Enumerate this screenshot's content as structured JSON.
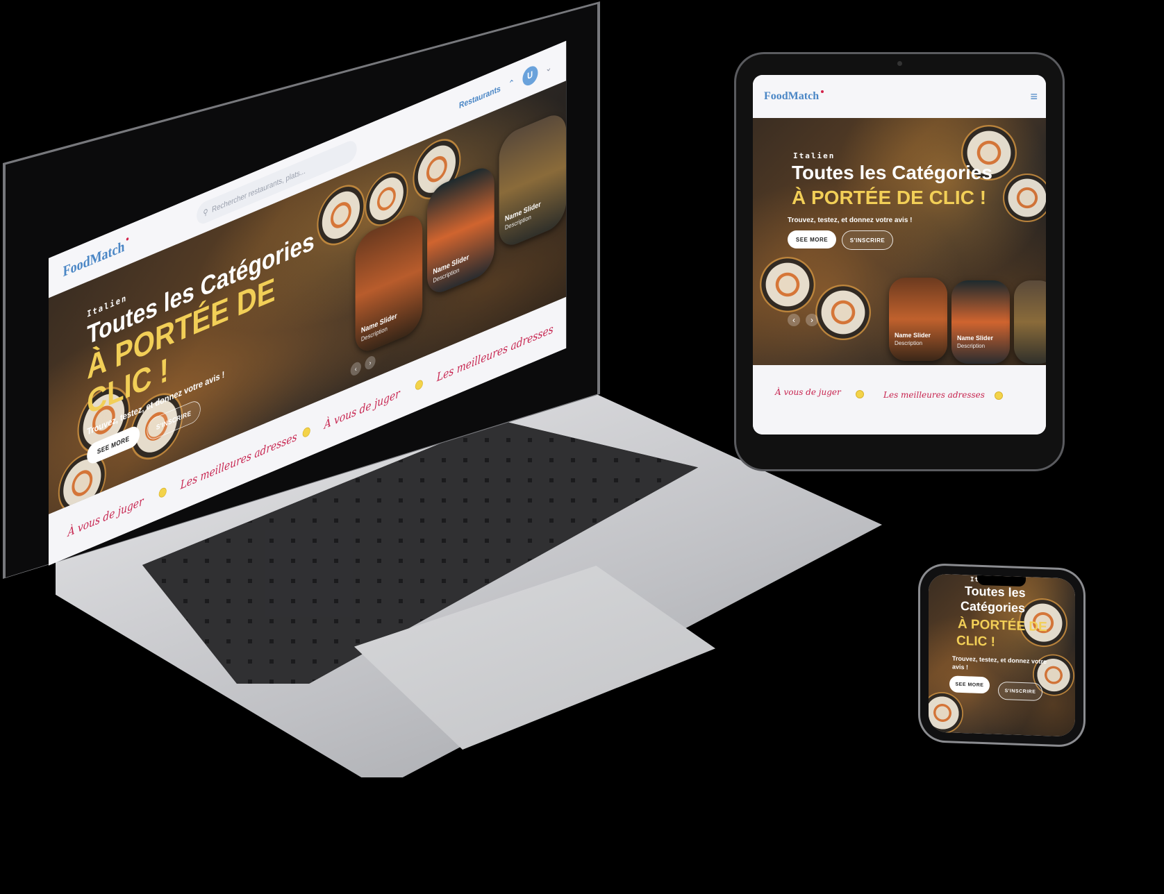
{
  "site": {
    "brand": "FoodMatch",
    "search_placeholder": "Rechercher restaurants, plats...",
    "nav_link": "Restaurants",
    "avatar_initial": "U",
    "hero": {
      "subtitle": "Italien",
      "title": "Toutes les Catégories",
      "highlight_laptop_line1": "À PORTÉE DE",
      "highlight_laptop_line2": "CLIC !",
      "highlight": "À PORTÉE DE CLIC !",
      "tagline": "Trouvez, testez, et donnez votre avis !",
      "see_more": "SEE MORE",
      "signup": "S'INSCRIRE"
    },
    "slider_cards": [
      {
        "name": "Name Slider",
        "description": "Description"
      },
      {
        "name": "Name Slider",
        "description": "Description"
      },
      {
        "name": "Name Slider",
        "description": "Description"
      },
      {
        "name": "Name Slider",
        "description": "Description"
      }
    ],
    "marquee": [
      "À vous de juger",
      "Les meilleures adresses",
      "À vous de juger",
      "Les meilleures adresses",
      "À vous de juger"
    ],
    "prev_glyph": "‹",
    "next_glyph": "›",
    "menu_glyph": "≡"
  },
  "phone": {
    "title_line1": "Toutes les",
    "title_line2": "Catégories",
    "highlight_line1": "À PORTÉE DE",
    "highlight_line2": "CLIC !",
    "tagline_line1": "Trouvez, testez, et donnez votre",
    "tagline_line2": "avis !"
  },
  "colors": {
    "brand_blue": "#4a86c5",
    "accent_red": "#c7244f",
    "highlight_yellow": "#f2cf57"
  }
}
